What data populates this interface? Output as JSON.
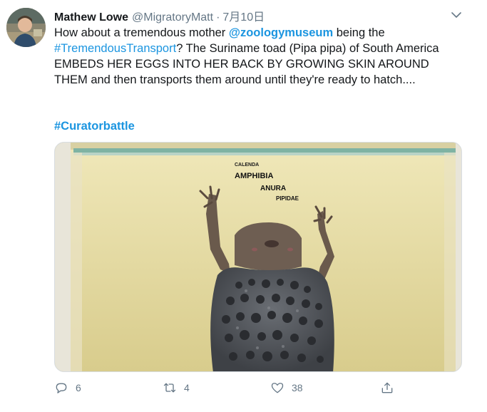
{
  "author": {
    "name": "Mathew Lowe",
    "handle": "@MigratoryMatt",
    "separator": "·",
    "date": "7月10日"
  },
  "tweet": {
    "t1": "How about a tremendous mother ",
    "mention": "@zoologymuseum",
    "t2": " being the",
    "hashtag1": "#TremendousTransport",
    "t3": "? The Suriname toad (Pipa pipa) of South America EMBEDS HER EGGS INTO HER BACK BY GROWING SKIN AROUND THEM and then transports them around until they're ready to hatch....",
    "hashtag2": "#Curatorbattle"
  },
  "media": {
    "label_class": "AMPHIBIA",
    "label_order": "ANURA",
    "label_family": "PIPIDAE",
    "label_partial": "CALENDA"
  },
  "actions": {
    "reply_count": "6",
    "retweet_count": "4",
    "like_count": "38"
  },
  "icons": {
    "reply": "reply-icon",
    "retweet": "retweet-icon",
    "like": "heart-icon",
    "share": "share-icon",
    "menu": "chevron-down-icon"
  },
  "colors": {
    "link": "#1b95e0",
    "secondary": "#657786",
    "text": "#14171a"
  }
}
